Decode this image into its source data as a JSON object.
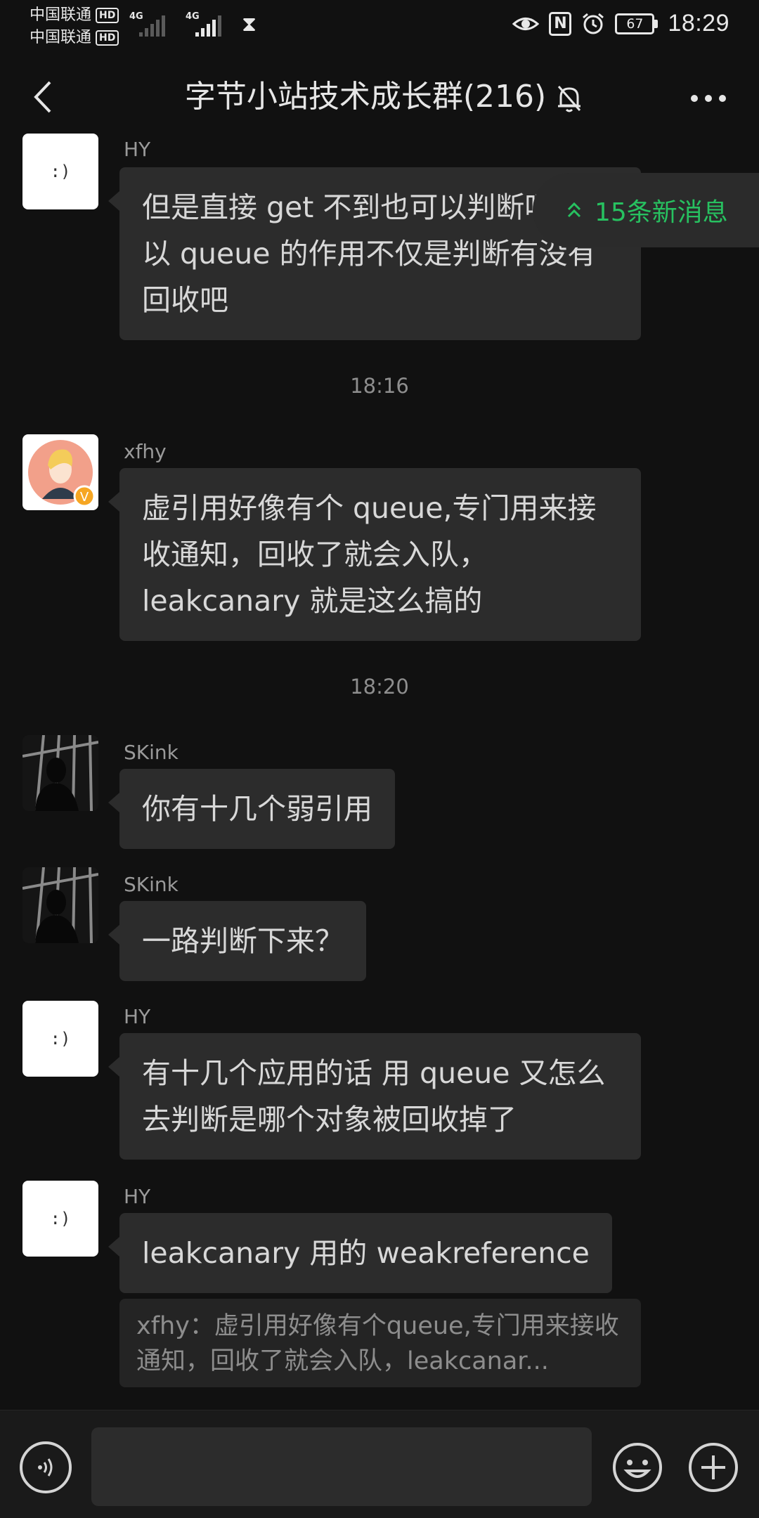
{
  "status_bar": {
    "carrier_1": "中国联通",
    "carrier_2": "中国联通",
    "hd_label": "HD",
    "network_1": "4G",
    "network_2": "4G",
    "battery_level": "67",
    "time": "18:29",
    "icons": [
      "hourglass-icon",
      "eye-icon",
      "nfc-icon",
      "alarm-icon",
      "battery-icon"
    ]
  },
  "header": {
    "title": "字节小站技术成长群(216)",
    "icons": [
      "back-arrow-icon",
      "mute-bell-icon",
      "more-dots-icon"
    ]
  },
  "new_messages_pill": {
    "label": "15条新消息",
    "accent_color": "#27c160"
  },
  "messages": [
    {
      "sender": "HY",
      "avatar_text": ":)",
      "text": "但是直接 get 不到也可以判断呀  所以 queue 的作用不仅是判断有没有回收吧"
    },
    {
      "timestamp": "18:16"
    },
    {
      "sender": "xfhy",
      "avatar_badge": "V",
      "text": "虚引用好像有个 queue,专门用来接收通知，回收了就会入队，leakcanary 就是这么搞的"
    },
    {
      "timestamp": "18:20"
    },
    {
      "sender": "SKink",
      "text": "你有十几个弱引用"
    },
    {
      "sender": "SKink",
      "text": "一路判断下来？"
    },
    {
      "sender": "HY",
      "avatar_text": ":)",
      "text": "有十几个应用的话  用 queue 又怎么去判断是哪个对象被回收掉了"
    },
    {
      "sender": "HY",
      "avatar_text": ":)",
      "text": "leakcanary 用的 weakreference",
      "quote": "xfhy：虚引用好像有个queue,专门用来接收通知，回收了就会入队，leakcanar..."
    }
  ],
  "input_bar": {
    "placeholder": "",
    "value": "",
    "icons": [
      "voice-icon",
      "emoji-icon",
      "plus-icon"
    ]
  },
  "colors": {
    "background": "#111111",
    "bubble": "#2c2c2c",
    "accent": "#27c160"
  }
}
